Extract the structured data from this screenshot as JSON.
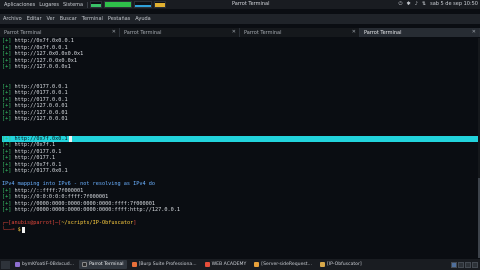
{
  "top_panel": {
    "apps_menu": "Aplicaciones",
    "places_menu": "Lugares",
    "system_menu": "Sistema",
    "window_title": "Parrot Terminal",
    "clock": "sab 5 de sep 10:50"
  },
  "menubar": {
    "items": [
      "Archivo",
      "Editar",
      "Ver",
      "Buscar",
      "Terminal",
      "Pestañas",
      "Ayuda"
    ]
  },
  "tabs": [
    {
      "label": "Parrot Terminal",
      "active": false
    },
    {
      "label": "Parrot Terminal",
      "active": false
    },
    {
      "label": "Parrot Terminal",
      "active": false
    },
    {
      "label": "Parrot Terminal",
      "active": true
    }
  ],
  "terminal": {
    "block1": [
      "http://0x7f.0x0.0.1",
      "http://0x7f.0.0.1",
      "http://127.0x0.0x0.0x1",
      "http://127.0.0x0.0x1",
      "http://127.0.0.0x1"
    ],
    "block2": [
      "http://0177.0.0.1",
      "http://0177.0.0.1",
      "http://0177.0.0.1",
      "http://127.0.0.01",
      "http://127.0.0.01",
      "http://127.0.0.01"
    ],
    "block3_highlight": "http://0x7f.0x0.1",
    "block3": [
      "http://0x7f.1",
      "http://0177.0.1",
      "http://0177.1",
      "http://0x7f.0.1",
      "http://0177.0x0.1"
    ],
    "ipv6_heading": "IPv4 mapping into IPv6 - not resolving as IPv4 do",
    "block4": [
      "http://::ffff:7f000001",
      "http://0:0:0:0:0:ffff:7f000001",
      "http://0000:0000:0000:0000:0000:ffff:7f000001",
      "http://0000:0000:0000:0000:0000:ffff:http://127.0.0.1"
    ],
    "plus": "[+]",
    "prompt": {
      "user_host": "anubis@parrot",
      "path": "~/scripts/IP-Obfuscator"
    }
  },
  "taskbar": {
    "tasks": [
      {
        "label": "bymKfoatiF-0Bdxcud...",
        "active": false
      },
      {
        "label": "Parrot Terminal",
        "active": true
      },
      {
        "label": "[Burp Suite Professiona...",
        "active": false
      },
      {
        "label": "WEB ACADEMY",
        "active": false
      },
      {
        "label": "[Server-sideRequest...",
        "active": false
      },
      {
        "label": "[IP-Obfuscator]",
        "active": false
      }
    ]
  }
}
